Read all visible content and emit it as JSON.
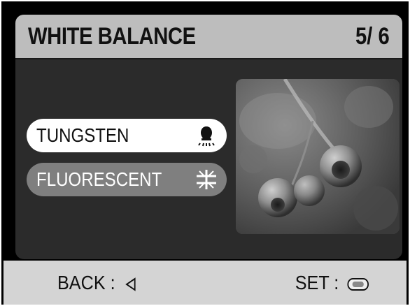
{
  "header": {
    "title": "WHITE BALANCE",
    "counter": "5/ 6"
  },
  "options": [
    {
      "label": "TUNGSTEN",
      "icon": "tungsten-bulb-icon",
      "selected": true
    },
    {
      "label": "FLUORESCENT",
      "icon": "fluorescent-icon",
      "selected": false
    }
  ],
  "footer": {
    "back_label": "BACK :",
    "back_icon": "left-arrow-icon",
    "set_label": "SET :",
    "set_icon": "ok-button-icon"
  },
  "colors": {
    "header_bg": "#bdbdbd",
    "screen_bg": "#2b2b2b",
    "selected_bg": "#ffffff",
    "unselected_bg": "#7f7f7f",
    "footer_bg": "#d4d4d4"
  }
}
